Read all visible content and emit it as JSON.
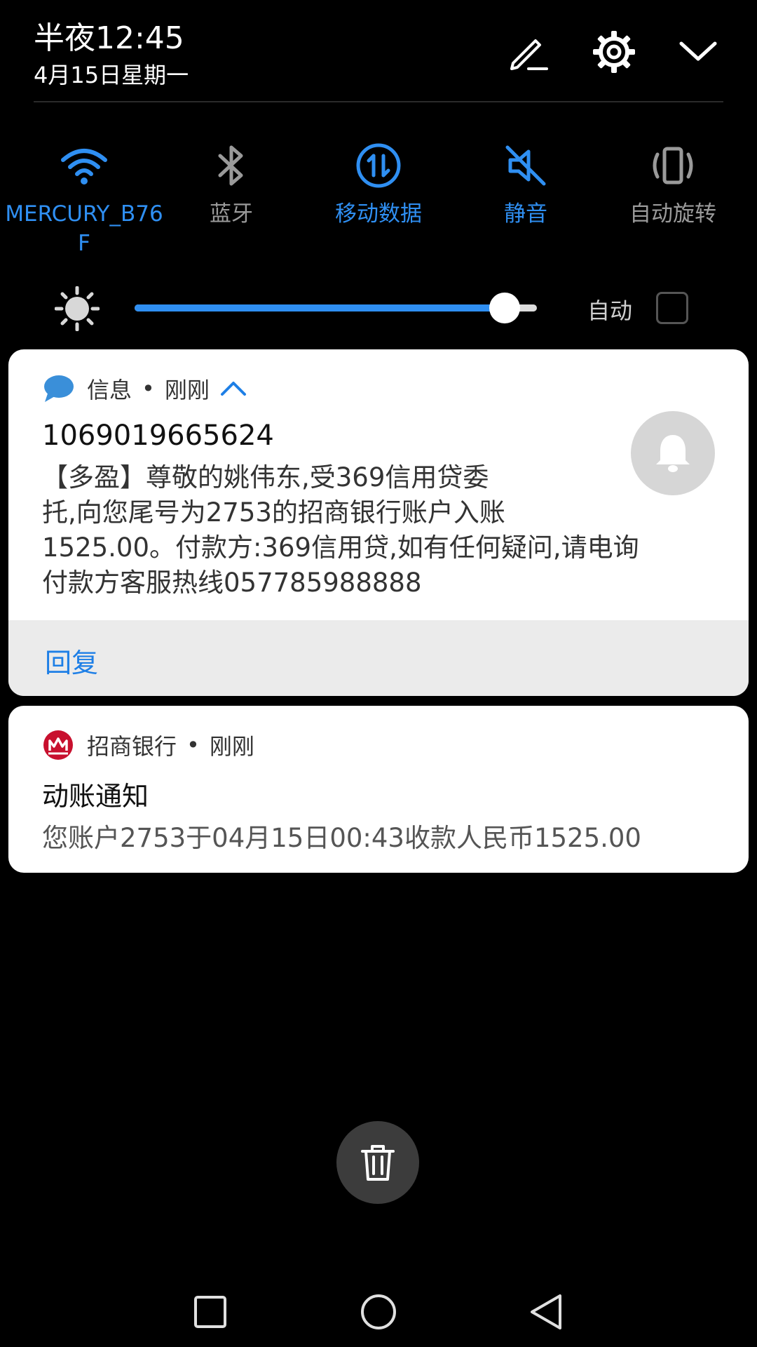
{
  "header": {
    "time": "半夜12:45",
    "date": "4月15日星期一"
  },
  "quick_settings": {
    "wifi": {
      "label_line1": "MERCURY_B76",
      "label_line2": "F",
      "active": true
    },
    "bluetooth": {
      "label": "蓝牙",
      "active": false
    },
    "mobile_data": {
      "label": "移动数据",
      "active": true
    },
    "silent": {
      "label": "静音",
      "active": true
    },
    "auto_rotate": {
      "label": "自动旋转",
      "active": false
    }
  },
  "brightness": {
    "level": 0.92,
    "auto_label": "自动",
    "auto_checked": false
  },
  "notifications": {
    "sms": {
      "app_name": "信息",
      "separator": "•",
      "when": "刚刚",
      "sender": "1069019665624",
      "body_lines": [
        "【多盈】尊敬的姚伟东,受369信用贷委",
        "托,向您尾号为2753的招商银行账户入账",
        "1525.00。付款方:369信用贷,如有任何疑问,请电询",
        "付款方客服热线057785988888"
      ],
      "reply_label": "回复"
    },
    "bank": {
      "app_name": "招商银行",
      "separator": "•",
      "when": "刚刚",
      "title": "动账通知",
      "body": "您账户2753于04月15日00:43收款人民币1525.00"
    }
  },
  "colors": {
    "accent": "#2f8ff2",
    "inactive": "#9a9a9a",
    "background": "#000000",
    "card": "#ffffff",
    "bank_red": "#c8102e"
  }
}
